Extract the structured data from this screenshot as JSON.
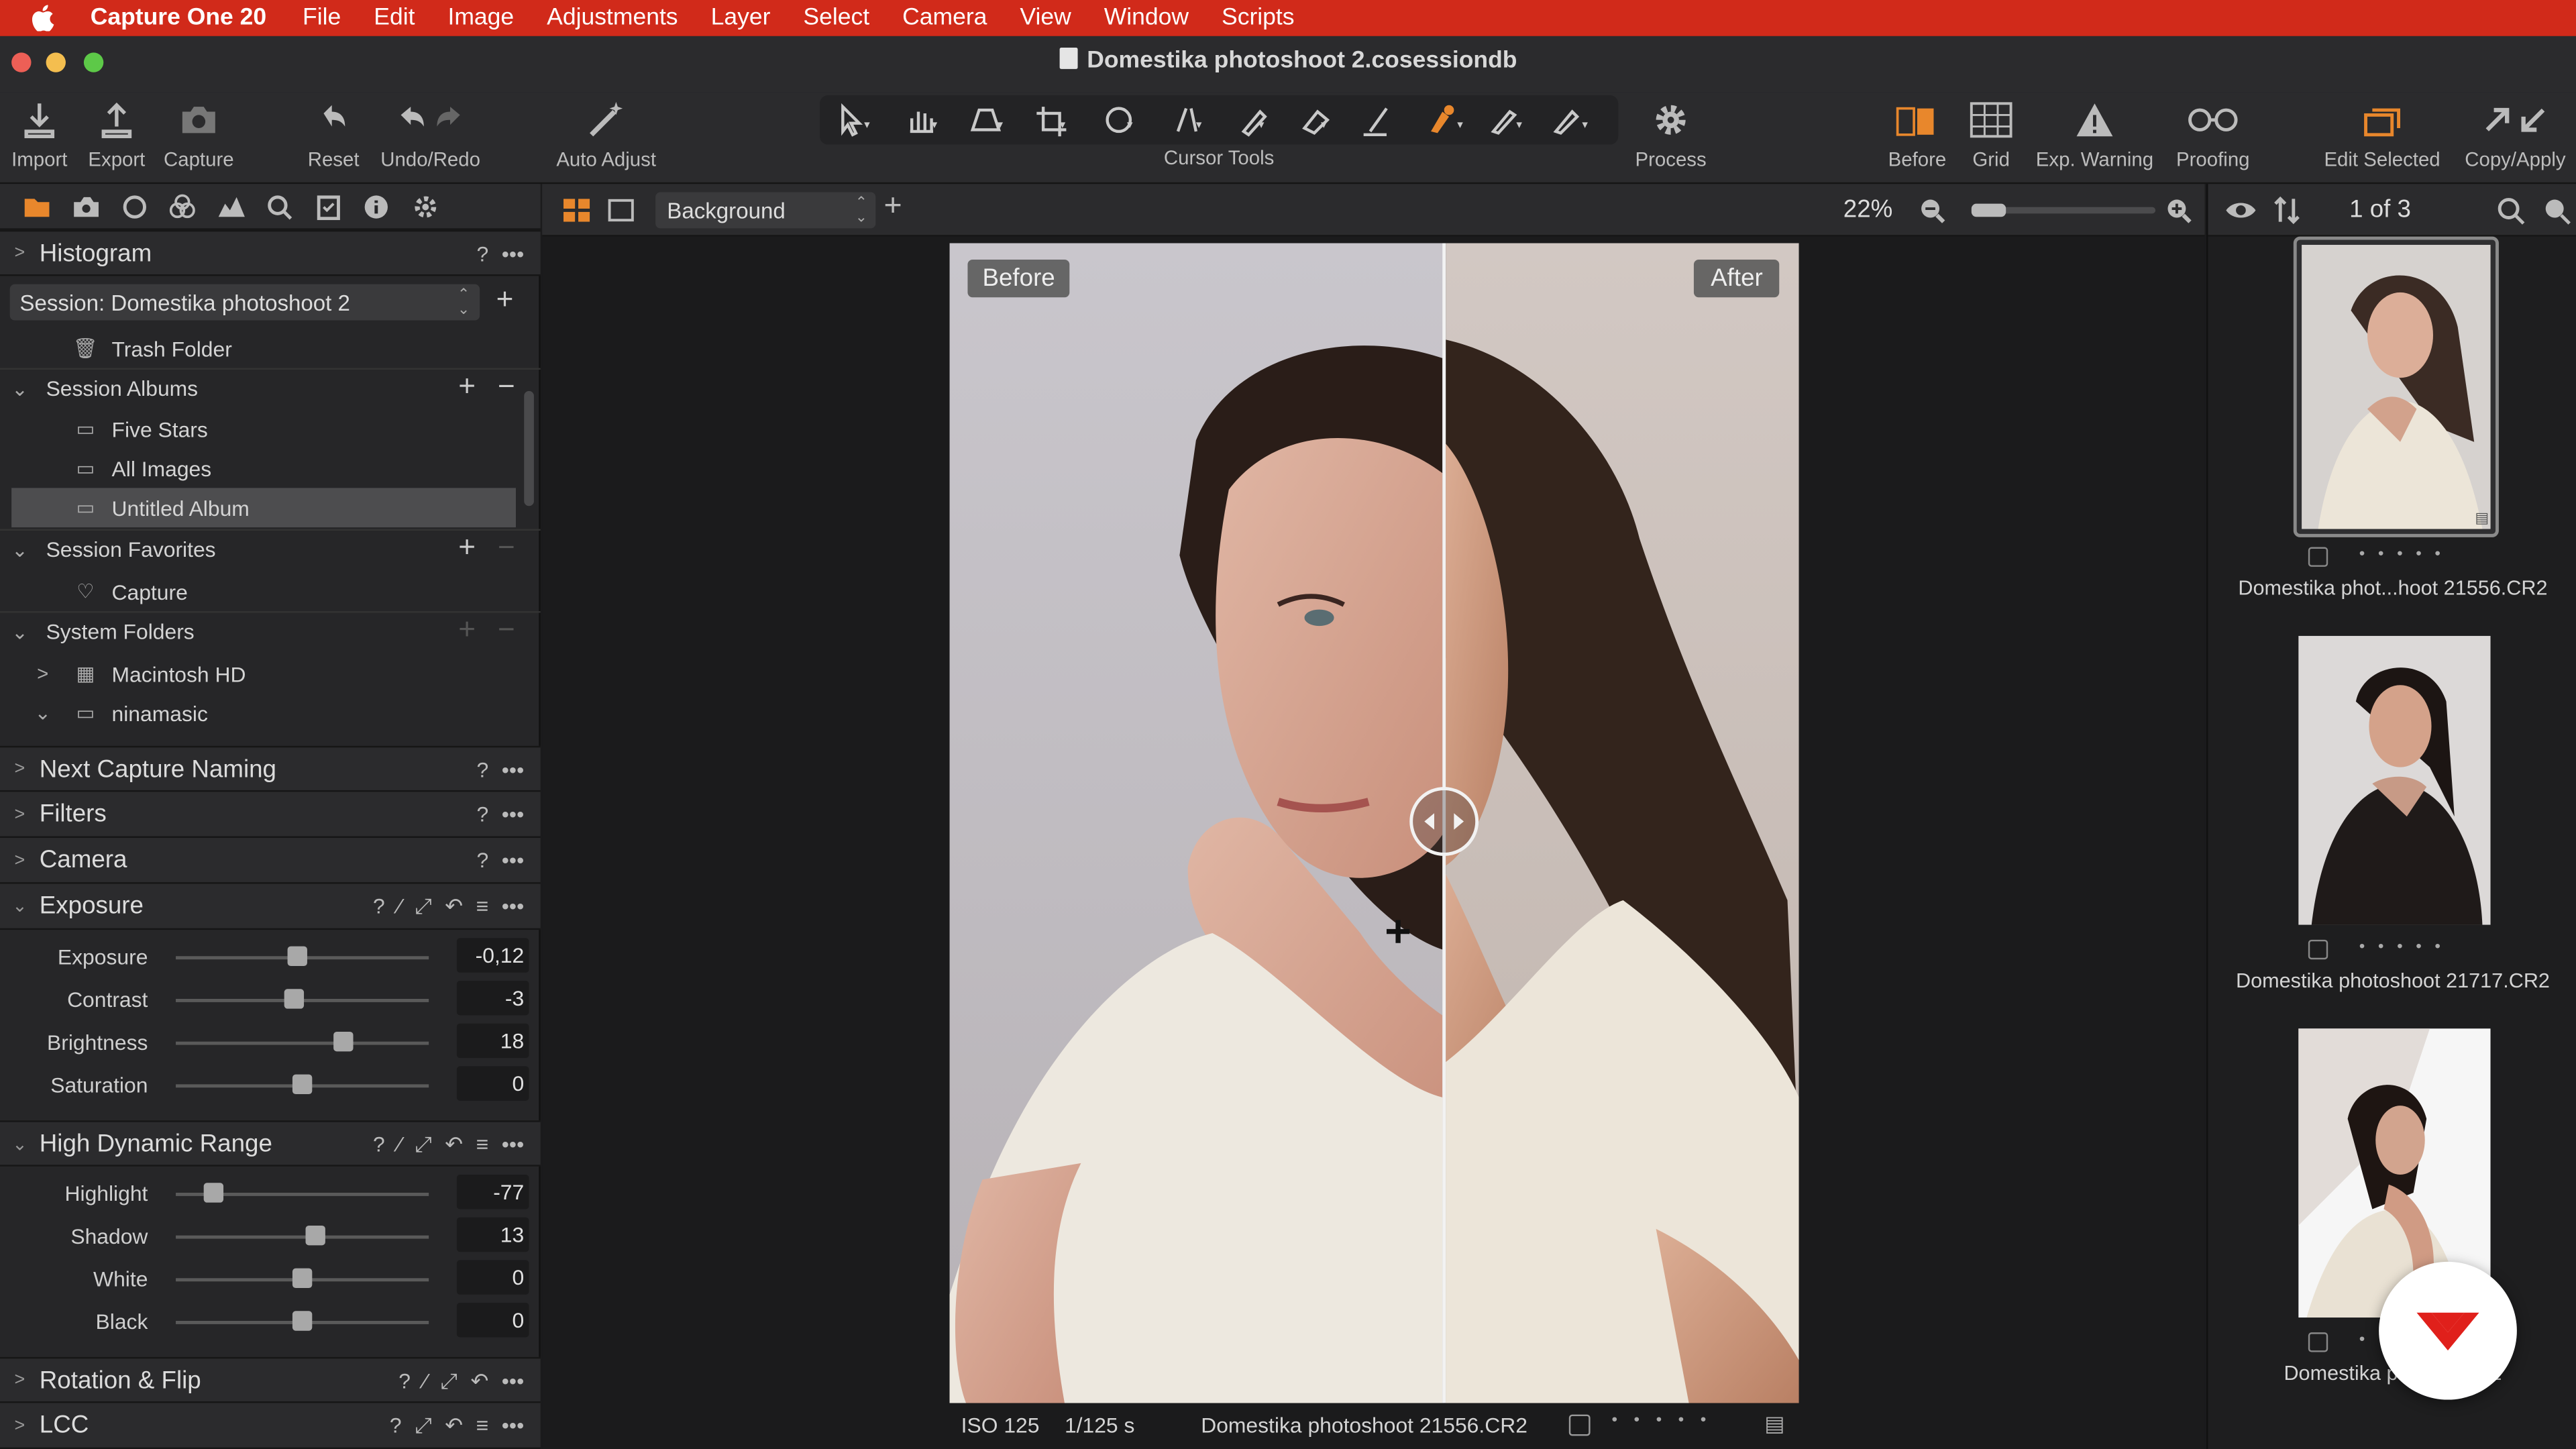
{
  "menubar": {
    "app_name": "Capture One 20",
    "items": [
      "File",
      "Edit",
      "Image",
      "Adjustments",
      "Layer",
      "Select",
      "Camera",
      "View",
      "Window",
      "Scripts"
    ]
  },
  "window": {
    "title": "Domestika photoshoot 2.cosessiondb"
  },
  "toolbar": {
    "import": "Import",
    "export": "Export",
    "capture": "Capture",
    "reset": "Reset",
    "undo_redo": "Undo/Redo",
    "auto_adjust": "Auto Adjust",
    "cursor_tools": "Cursor Tools",
    "process": "Process",
    "before": "Before",
    "grid": "Grid",
    "exp_warning": "Exp. Warning",
    "proofing": "Proofing",
    "edit_selected": "Edit Selected",
    "copy_apply": "Copy/Apply"
  },
  "library": {
    "histogram": "Histogram",
    "session_select": "Session: Domestika photoshoot 2",
    "trash": "Trash Folder",
    "session_albums": "Session Albums",
    "albums": [
      "Five Stars",
      "All Images",
      "Untitled Album"
    ],
    "session_favorites": "Session Favorites",
    "favorites": [
      "Capture"
    ],
    "system_folders": "System Folders",
    "folders": [
      "Macintosh HD",
      "ninamasic"
    ]
  },
  "tools": {
    "next_capture_naming": "Next Capture Naming",
    "filters": "Filters",
    "camera": "Camera",
    "exposure": {
      "title": "Exposure",
      "sliders": [
        {
          "label": "Exposure",
          "value": "-0,12",
          "pos": 0.49
        },
        {
          "label": "Contrast",
          "value": "-3",
          "pos": 0.47
        },
        {
          "label": "Brightness",
          "value": "18",
          "pos": 0.66
        },
        {
          "label": "Saturation",
          "value": "0",
          "pos": 0.5
        }
      ]
    },
    "hdr": {
      "title": "High Dynamic Range",
      "sliders": [
        {
          "label": "Highlight",
          "value": "-77",
          "pos": 0.15
        },
        {
          "label": "Shadow",
          "value": "13",
          "pos": 0.56
        },
        {
          "label": "White",
          "value": "0",
          "pos": 0.5
        },
        {
          "label": "Black",
          "value": "0",
          "pos": 0.5
        }
      ]
    },
    "rotation_flip": "Rotation & Flip",
    "lcc": "LCC"
  },
  "viewer": {
    "layer": "Background",
    "zoom": "22%",
    "before_label": "Before",
    "after_label": "After",
    "iso": "ISO 125",
    "shutter": "1/125 s",
    "filename": "Domestika photoshoot 21556.CR2"
  },
  "browser": {
    "count": "1 of 3",
    "thumbs": [
      {
        "name": "Domestika phot...hoot 21556.CR2"
      },
      {
        "name": "Domestika photoshoot 21717.CR2"
      },
      {
        "name": "Domestika phot...6.CR2"
      }
    ]
  },
  "colors": {
    "accent": "#e8872c",
    "menubar": "#d12a1a",
    "domestika_badge": "#e0201b"
  }
}
